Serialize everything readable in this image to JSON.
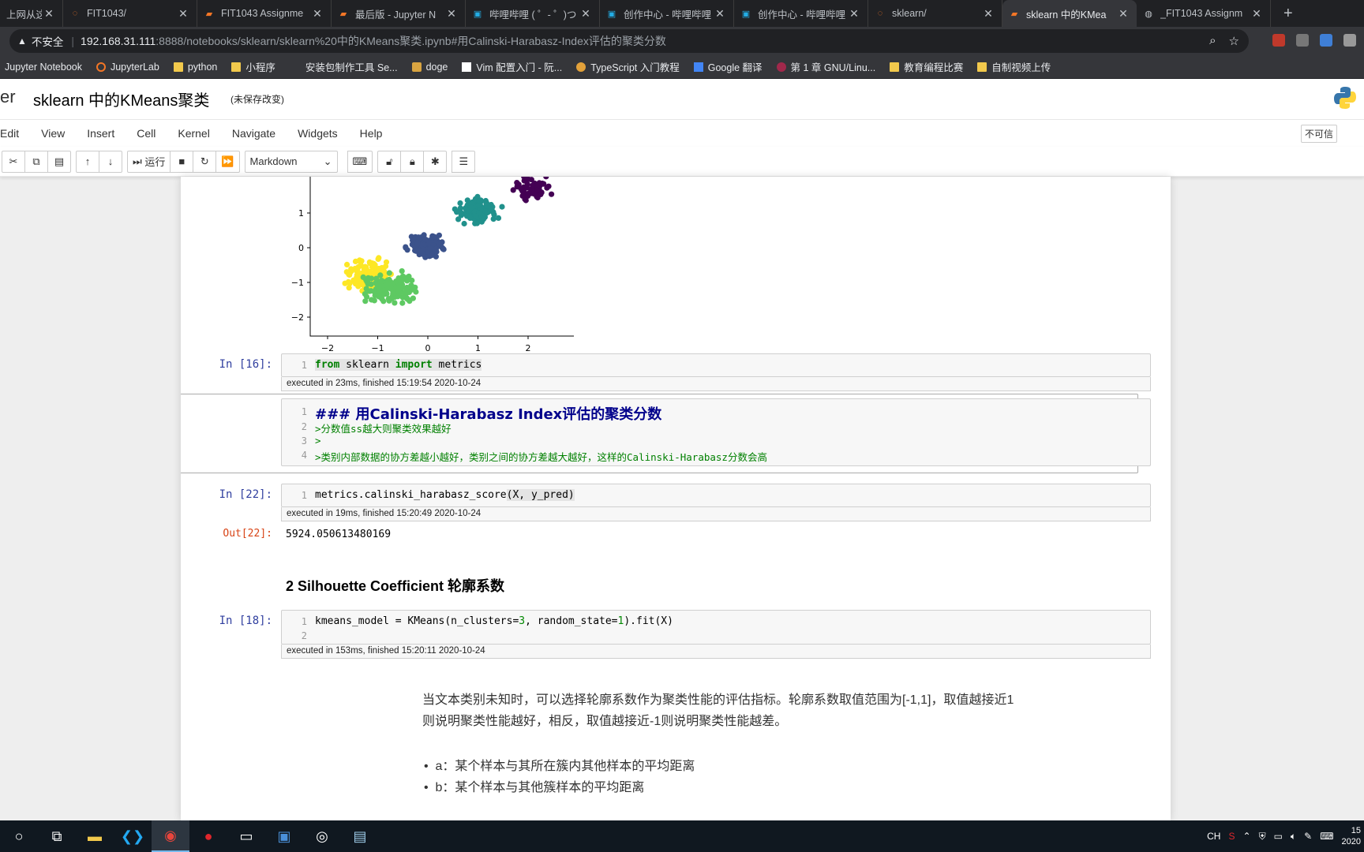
{
  "browser": {
    "tabs": [
      {
        "title": "上网从这里"
      },
      {
        "title": "FIT1043/"
      },
      {
        "title": "FIT1043 Assignme"
      },
      {
        "title": "最后版 - Jupyter N"
      },
      {
        "title": "哔哩哔哩 ( ゜- ゜)つ"
      },
      {
        "title": "创作中心 - 哔哩哔哩"
      },
      {
        "title": "创作中心 - 哔哩哔哩"
      },
      {
        "title": "sklearn/"
      },
      {
        "title": "sklearn 中的KMea"
      },
      {
        "title": "_FIT1043 Assignm"
      }
    ],
    "security_label": "不安全",
    "url_host": "192.168.31.111",
    "url_path": ":8888/notebooks/sklearn/sklearn%20中的KMeans聚类.ipynb#用Calinski-Harabasz-Index评估的聚类分数",
    "bookmarks": [
      {
        "label": "Jupyter Notebook"
      },
      {
        "label": "JupyterLab"
      },
      {
        "label": "python"
      },
      {
        "label": "小程序"
      },
      {
        "label": "安装包制作工具 Se..."
      },
      {
        "label": "doge"
      },
      {
        "label": "Vim 配置入门 - 阮..."
      },
      {
        "label": "TypeScript 入门教程"
      },
      {
        "label": "Google 翻译"
      },
      {
        "label": "第 1 章 GNU/Linu..."
      },
      {
        "label": "教育编程比赛"
      },
      {
        "label": "自制视频上传"
      }
    ]
  },
  "jupyter": {
    "logo_text": "er",
    "title": "sklearn 中的KMeans聚类",
    "unsaved": "(未保存改变)",
    "menu": [
      "Edit",
      "View",
      "Insert",
      "Cell",
      "Kernel",
      "Navigate",
      "Widgets",
      "Help"
    ],
    "trusted": "不可信",
    "run_label": "运行",
    "cell_type": "Markdown"
  },
  "plot": {
    "y_ticks": [
      "1",
      "0",
      "−1",
      "−2"
    ],
    "x_ticks": [
      "−2",
      "−1",
      "0",
      "1",
      "2"
    ]
  },
  "cells": {
    "c16": {
      "prompt": "In  [16]:",
      "line_nums": [
        "1"
      ],
      "code_from": "from",
      "code_mod": " sklearn ",
      "code_import": "import",
      "code_rest": " metrics",
      "exec": "executed in 23ms, finished 15:19:54 2020-10-24"
    },
    "md": {
      "line_nums": [
        "1",
        "2",
        "3",
        "4"
      ],
      "lines": [
        "### 用Calinski-Harabasz Index评估的聚类分数",
        ">分数值ss越大则聚类效果越好",
        ">",
        ">类别内部数据的协方差越小越好，类别之间的协方差越大越好，这样的Calinski-Harabasz分数会高"
      ]
    },
    "c22": {
      "prompt": "In  [22]:",
      "line_nums": [
        "1"
      ],
      "code_a": "metrics.calinski_harabasz_score",
      "code_b": "(X, y_pred)",
      "exec": "executed in 19ms, finished 15:20:49 2020-10-24",
      "out_prompt": "Out[22]:",
      "output": "5924.050613480169"
    },
    "heading": "2  Silhouette Coefficient 轮廓系数",
    "c18": {
      "prompt": "In  [18]:",
      "line_nums": [
        "1",
        "2"
      ],
      "code_a": "kmeans_model = KMeans(n_clusters=",
      "code_n1": "3",
      "code_b": ", random_state=",
      "code_n2": "1",
      "code_c": ").fit(X)",
      "exec": "executed in 153ms, finished 15:20:11 2020-10-24"
    },
    "para": "当文本类别未知时，可以选择轮廓系数作为聚类性能的评估指标。轮廓系数取值范围为[-1,1]，取值越接近1则说明聚类性能越好，相反，取值越接近-1则说明聚类性能越差。",
    "bullets": [
      "a：某个样本与其所在簇内其他样本的平均距离",
      "b：某个样本与其他簇样本的平均距离"
    ]
  },
  "taskbar": {
    "ime": "CH",
    "time": "15",
    "date": "2020"
  },
  "colors": {
    "accent_selected": "#42a5f5",
    "prompt_in": "#303f9f",
    "prompt_out": "#d84315",
    "cluster_yellow": "#fde725",
    "cluster_green": "#5ec962",
    "cluster_navy": "#3b528b",
    "cluster_teal": "#21918c",
    "cluster_purple": "#440154"
  }
}
